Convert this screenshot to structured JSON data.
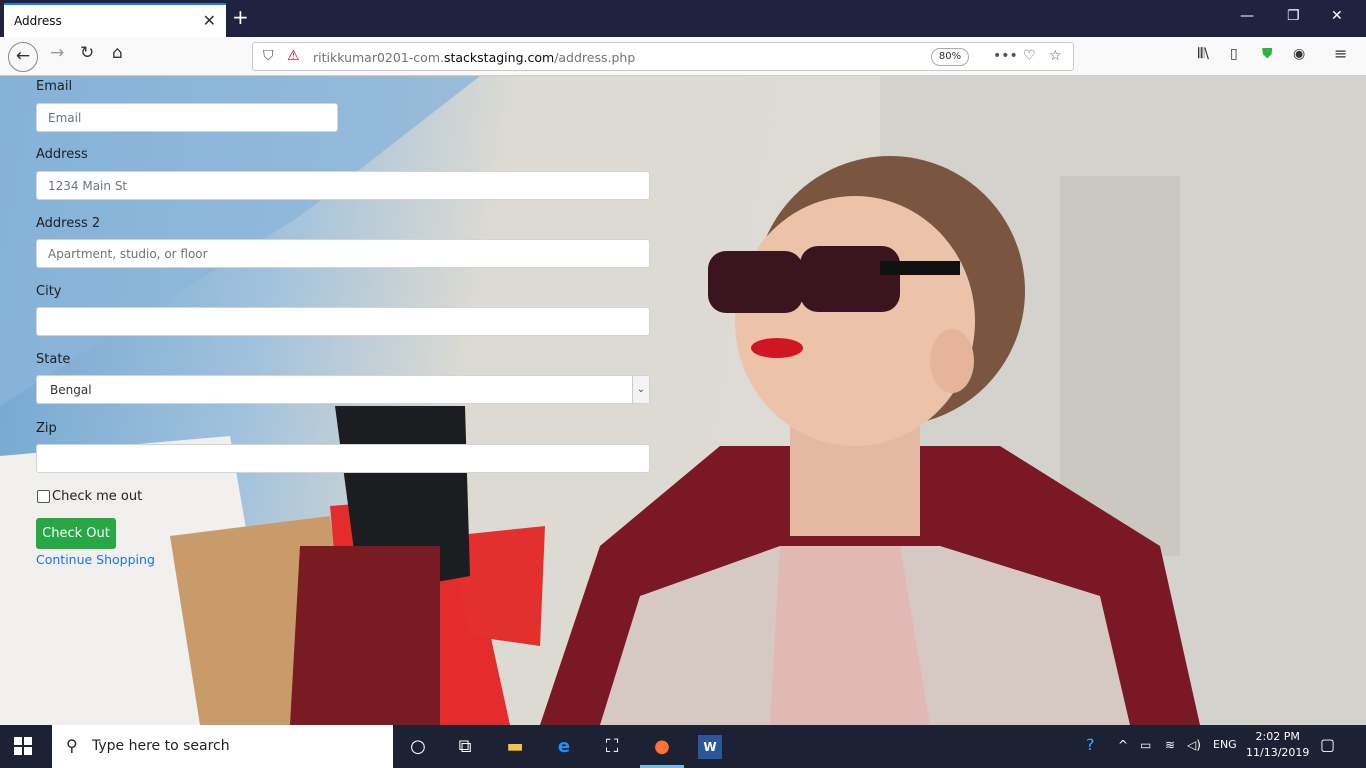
{
  "browser": {
    "tab_title": "Address",
    "tab_close": "✕",
    "new_tab": "+",
    "url_prefix": "ritikkumar0201-com.",
    "url_domain": "stackstaging.com",
    "url_path": "/address.php",
    "zoom": "80%"
  },
  "form": {
    "email_label": "Email",
    "email_placeholder": "Email",
    "address_label": "Address",
    "address_placeholder": "1234 Main St",
    "address2_label": "Address 2",
    "address2_placeholder": "Apartment, studio, or floor",
    "city_label": "City",
    "state_label": "State",
    "state_value": "Bengal",
    "zip_label": "Zip",
    "checkbox_label": "Check me out",
    "checkout_button": "Check Out",
    "continue_link": "Continue Shopping"
  },
  "taskbar": {
    "search_placeholder": "Type here to search",
    "language": "ENG",
    "time": "2:02 PM",
    "date": "11/13/2019"
  },
  "colors": {
    "tabbar": "#202340",
    "accent": "#0a84ff",
    "button_green": "#28a745",
    "link_blue": "#1a73e8",
    "taskbar": "#1c2133"
  }
}
